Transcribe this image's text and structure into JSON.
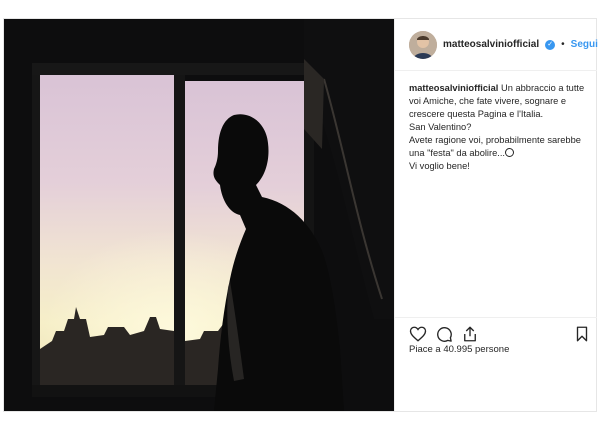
{
  "post": {
    "username": "matteosalviniofficial",
    "follow_label": "Segui",
    "separator": "•",
    "caption_lines": [
      "Un abbraccio a tutte",
      "voi Amiche, che fate vivere, sognare e",
      "crescere questa Pagina e l'Italia.",
      "San Valentino?",
      "Avete ragione voi, probabilmente sarebbe",
      "una \"festa\" da abolire...",
      "Vi voglio bene!"
    ],
    "likes_text": "Piace a 40.995 persone"
  },
  "icons": {
    "verified": "verified-badge-icon",
    "like": "heart-icon",
    "comment": "comment-icon",
    "share": "share-icon",
    "save": "bookmark-icon",
    "emoji": "worried-face-emoji"
  },
  "colors": {
    "accent": "#3897f0",
    "text": "#262626",
    "border": "#efefef"
  }
}
